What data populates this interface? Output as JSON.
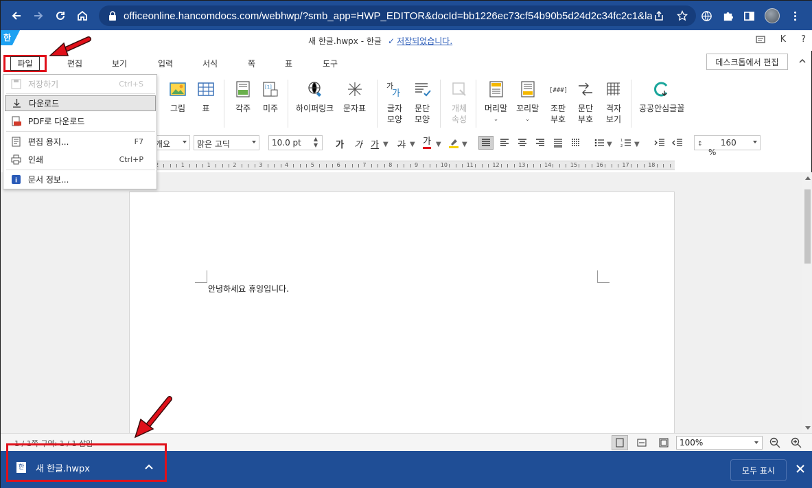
{
  "browser": {
    "url": "officeonline.hancomdocs.com/webhwp/?smb_app=HWP_EDITOR&docId=bb1226ec73cf54b90b5d24d2c34fc2c1&lang=..."
  },
  "app": {
    "logo_text": "한",
    "doc_title": "새 한글.hwpx - 한글",
    "saved_status": "저장되었습니다.",
    "user_initial": "K",
    "help_label": "?"
  },
  "menu": {
    "file": "파일",
    "items": [
      "편집",
      "보기",
      "입력",
      "서식",
      "쪽",
      "표",
      "도구"
    ],
    "desktop_edit": "데스크톱에서 편집"
  },
  "ribbon": {
    "picture": "그림",
    "table": "표",
    "footnote": "각주",
    "endnote": "미주",
    "hyperlink": "하이퍼링크",
    "char_map": "문자표",
    "char_shape_1": "글자",
    "char_shape_2": "모양",
    "para_shape_1": "문단",
    "para_shape_2": "모양",
    "object_1": "개체",
    "object_2": "속성",
    "header": "머리말",
    "footer": "꼬리말",
    "assemble_1": "조판",
    "assemble_2": "부호",
    "para_mark_1": "문단",
    "para_mark_2": "부호",
    "grid_1": "격자",
    "grid_2": "보기",
    "safe_font": "공공안심글꼴"
  },
  "format": {
    "style": "개요",
    "font": "맑은 고딕",
    "size": "10.0",
    "unit": "pt",
    "bold": "가",
    "italic": "가",
    "underline": "가",
    "strike": "가",
    "color": "가",
    "line_spacing": "160",
    "percent": "%"
  },
  "ruler": {
    "numbers": [
      "2",
      "1",
      "1",
      "2",
      "3",
      "4",
      "5",
      "6",
      "7",
      "8",
      "9",
      "10",
      "11",
      "12",
      "13",
      "14",
      "15",
      "16",
      "17",
      "18"
    ]
  },
  "document": {
    "text": "안녕하세요 휴잉입니다."
  },
  "status": {
    "text": "1 / 1쪽    구역: 1 / 1    삽입",
    "zoom": "100%"
  },
  "file_menu": {
    "save": {
      "label": "저장하기",
      "shortcut": "Ctrl+S"
    },
    "download": {
      "label": "다운로드"
    },
    "pdf": {
      "label": "PDF로 다운로드"
    },
    "page_setup": {
      "label": "편집 용지...",
      "shortcut": "F7"
    },
    "print": {
      "label": "인쇄",
      "shortcut": "Ctrl+P"
    },
    "doc_info": {
      "label": "문서 정보..."
    }
  },
  "downloads": {
    "file_name": "새 한글.hwpx",
    "icon_text": "한",
    "show_all": "모두 표시"
  },
  "colors": {
    "chrome_blue": "#1f4e96",
    "highlight_red": "#e0101a",
    "link_blue": "#2a5bb8"
  }
}
